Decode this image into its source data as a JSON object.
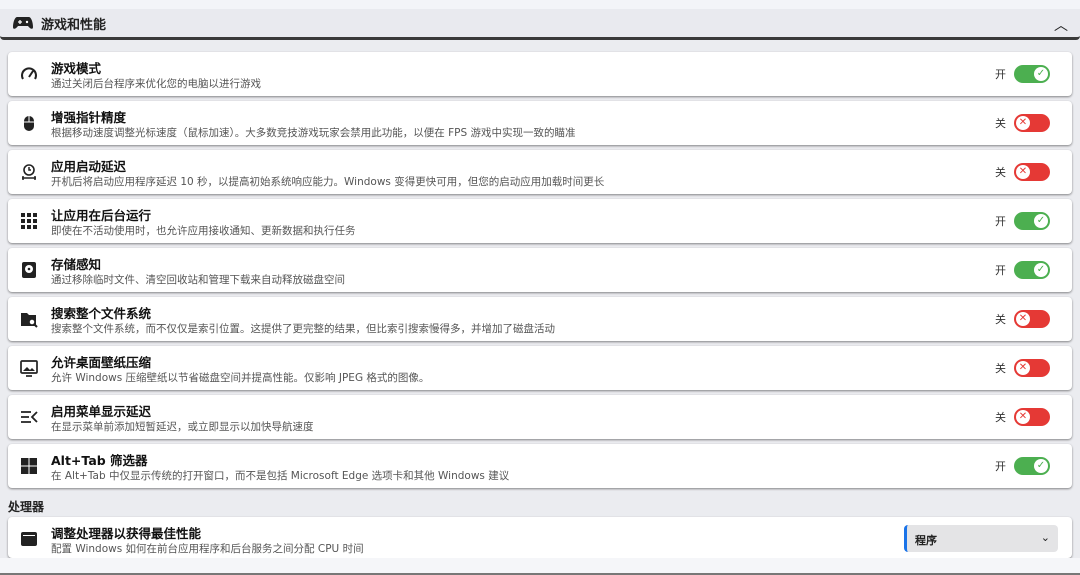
{
  "header": {
    "title": "游戏和性能",
    "icon": "gamepad-icon"
  },
  "items": [
    {
      "title": "游戏模式",
      "desc": "通过关闭后台程序来优化您的电脑以进行游戏",
      "state": "开",
      "on": true,
      "icon": "speedometer-icon"
    },
    {
      "title": "增强指针精度",
      "desc": "根据移动速度调整光标速度（鼠标加速）。大多数竞技游戏玩家会禁用此功能，以便在 FPS 游戏中实现一致的瞄准",
      "state": "关",
      "on": false,
      "icon": "mouse-icon"
    },
    {
      "title": "应用启动延迟",
      "desc": "开机后将启动应用程序延迟 10 秒，以提高初始系统响应能力。Windows 变得更快可用，但您的启动应用加载时间更长",
      "state": "关",
      "on": false,
      "icon": "startup-delay-icon"
    },
    {
      "title": "让应用在后台运行",
      "desc": "即使在不活动使用时，也允许应用接收通知、更新数据和执行任务",
      "state": "开",
      "on": true,
      "icon": "apps-grid-icon"
    },
    {
      "title": "存储感知",
      "desc": "通过移除临时文件、清空回收站和管理下载来自动释放磁盘空间",
      "state": "开",
      "on": true,
      "icon": "storage-icon"
    },
    {
      "title": "搜索整个文件系统",
      "desc": "搜索整个文件系统，而不仅仅是索引位置。这提供了更完整的结果，但比索引搜索慢得多，并增加了磁盘活动",
      "state": "关",
      "on": false,
      "icon": "folder-search-icon"
    },
    {
      "title": "允许桌面壁纸压缩",
      "desc": "允许 Windows 压缩壁纸以节省磁盘空间并提高性能。仅影响 JPEG 格式的图像。",
      "state": "关",
      "on": false,
      "icon": "wallpaper-icon"
    },
    {
      "title": "启用菜单显示延迟",
      "desc": "在显示菜单前添加短暂延迟，或立即显示以加快导航速度",
      "state": "关",
      "on": false,
      "icon": "menu-delay-icon"
    },
    {
      "title": "Alt+Tab 筛选器",
      "desc": "在 Alt+Tab 中仅显示传统的打开窗口，而不是包括 Microsoft Edge 选项卡和其他 Windows 建议",
      "state": "开",
      "on": true,
      "icon": "windows-icon"
    }
  ],
  "processor": {
    "section": "处理器",
    "title": "调整处理器以获得最佳性能",
    "desc": "配置 Windows 如何在前台应用程序和后台服务之间分配 CPU 时间",
    "value": "程序",
    "chevron": "⌄"
  }
}
